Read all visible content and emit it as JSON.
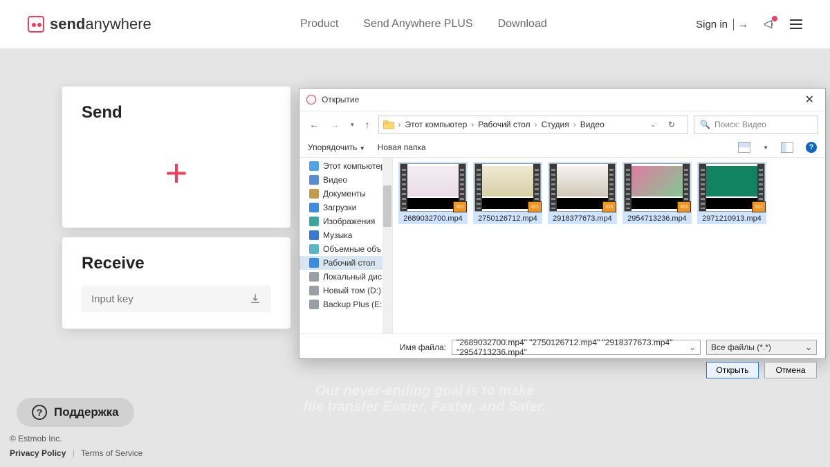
{
  "header": {
    "logo_main": "send",
    "logo_sub": "anywhere",
    "nav": [
      "Product",
      "Send Anywhere PLUS",
      "Download"
    ],
    "signin": "Sign in"
  },
  "send": {
    "title": "Send"
  },
  "receive": {
    "title": "Receive",
    "placeholder": "Input key"
  },
  "slogan": {
    "l1": "Our never-ending goal is to make",
    "l2": "file transfer Easier, Faster, and Safer."
  },
  "support": "Поддержка",
  "legal": {
    "copyright": "© Estmob Inc.",
    "privacy": "Privacy Policy",
    "terms": "Terms of Service"
  },
  "dialog": {
    "title": "Открытие",
    "breadcrumb": [
      "Этот компьютер",
      "Рабочий стол",
      "Студия",
      "Видео"
    ],
    "search_placeholder": "Поиск: Видео",
    "toolbar": {
      "org": "Упорядочить",
      "newfolder": "Новая папка"
    },
    "tree": [
      {
        "label": "Этот компьютер",
        "icon": "pc"
      },
      {
        "label": "Видео",
        "icon": "folder-blue"
      },
      {
        "label": "Документы",
        "icon": "doc"
      },
      {
        "label": "Загрузки",
        "icon": "download"
      },
      {
        "label": "Изображения",
        "icon": "images"
      },
      {
        "label": "Музыка",
        "icon": "music"
      },
      {
        "label": "Объемные объ",
        "icon": "cube"
      },
      {
        "label": "Рабочий стол",
        "icon": "desktop",
        "selected": true
      },
      {
        "label": "Локальный дис",
        "icon": "disk"
      },
      {
        "label": "Новый том (D:)",
        "icon": "disk"
      },
      {
        "label": "Backup Plus  (E:)",
        "icon": "disk"
      }
    ],
    "files": [
      {
        "name": "2689032700.mp4",
        "bg": "linear-gradient(#f3eef2,#eadbe6)"
      },
      {
        "name": "2750126712.mp4",
        "bg": "linear-gradient(#efe9d1,#d8cfa6)"
      },
      {
        "name": "2918377673.mp4",
        "bg": "linear-gradient(#f6f3ee,#cfc7b8)"
      },
      {
        "name": "2954713236.mp4",
        "bg": "linear-gradient(135deg,#e07ba4,#83c791)"
      },
      {
        "name": "2971210913.mp4",
        "bg": "linear-gradient(#11835e,#11835e)"
      }
    ],
    "fn_label": "Имя файла:",
    "fn_value": "\"2689032700.mp4\" \"2750126712.mp4\" \"2918377673.mp4\" \"2954713236.mp4\"",
    "filter": "Все файлы (*.*)",
    "open": "Открыть",
    "cancel": "Отмена"
  }
}
